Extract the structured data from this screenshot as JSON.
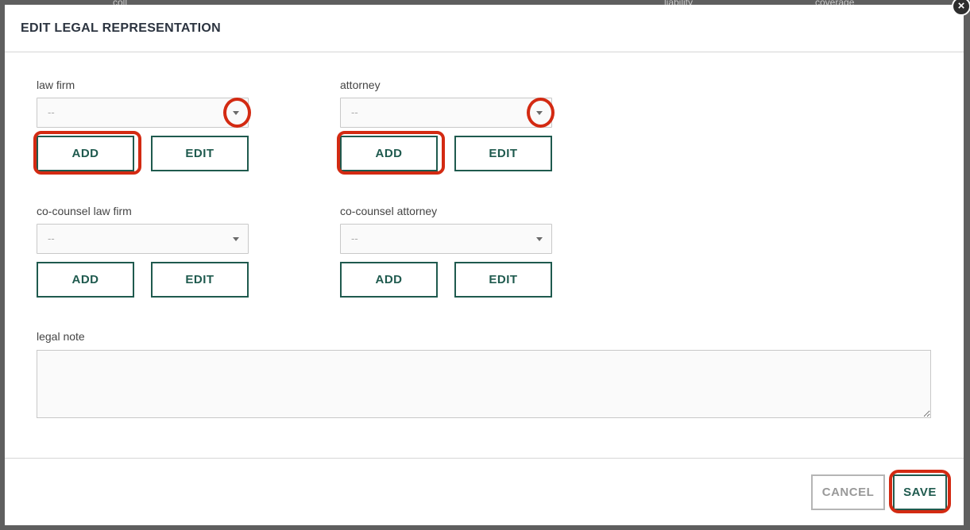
{
  "background": {
    "col1": "coll",
    "col2": "liability",
    "col3": "coverage"
  },
  "dialog": {
    "title": "EDIT LEGAL REPRESENTATION",
    "close_glyph": "×"
  },
  "fields": {
    "law_firm": {
      "label": "law firm",
      "value": "--",
      "add_label": "ADD",
      "edit_label": "EDIT"
    },
    "attorney": {
      "label": "attorney",
      "value": "--",
      "add_label": "ADD",
      "edit_label": "EDIT"
    },
    "co_counsel_law_firm": {
      "label": "co-counsel law firm",
      "value": "--",
      "add_label": "ADD",
      "edit_label": "EDIT"
    },
    "co_counsel_attorney": {
      "label": "co-counsel attorney",
      "value": "--",
      "add_label": "ADD",
      "edit_label": "EDIT"
    },
    "legal_note": {
      "label": "legal note",
      "value": ""
    }
  },
  "footer": {
    "cancel_label": "CANCEL",
    "save_label": "SAVE"
  },
  "colors": {
    "accent": "#1f5a4e",
    "highlight": "#d32a12",
    "overlay": "#5f5f5f"
  }
}
